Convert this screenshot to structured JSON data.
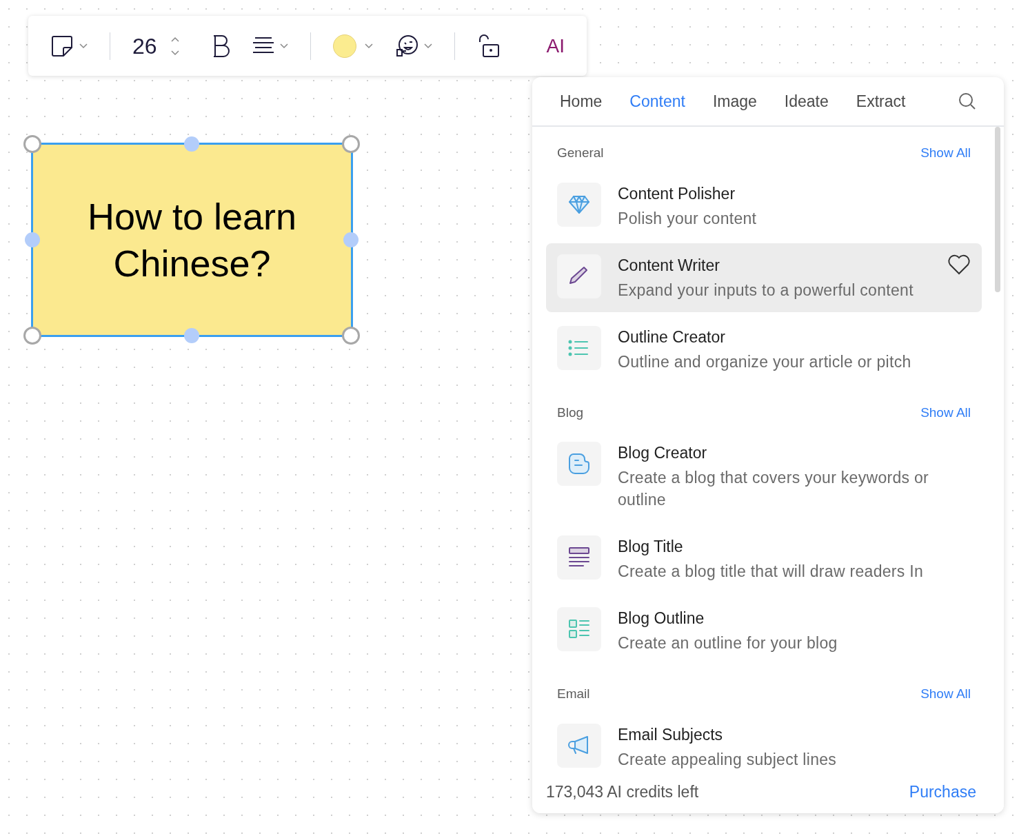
{
  "toolbar": {
    "font_size": "26",
    "ai_label": "AI"
  },
  "note": {
    "text": "How to learn Chinese?",
    "color": "#fbe98f",
    "selected": true
  },
  "panel": {
    "tabs": [
      {
        "label": "Home",
        "selected": false
      },
      {
        "label": "Content",
        "selected": true
      },
      {
        "label": "Image",
        "selected": false
      },
      {
        "label": "Ideate",
        "selected": false
      },
      {
        "label": "Extract",
        "selected": false
      }
    ],
    "sections": [
      {
        "title": "General",
        "action": "Show All",
        "items": [
          {
            "title": "Content Polisher",
            "description": "Polish your content",
            "selected": false
          },
          {
            "title": "Content Writer",
            "description": "Expand your inputs to a powerful content",
            "selected": true
          },
          {
            "title": "Outline Creator",
            "description": "Outline and organize your article or pitch",
            "selected": false
          }
        ]
      },
      {
        "title": "Blog",
        "action": "Show All",
        "items": [
          {
            "title": "Blog Creator",
            "description": "Create a blog that covers your keywords or outline",
            "selected": false
          },
          {
            "title": "Blog Title",
            "description": "Create a blog title that will draw readers In",
            "selected": false
          },
          {
            "title": "Blog Outline",
            "description": "Create an outline for your blog",
            "selected": false
          }
        ]
      },
      {
        "title": "Email",
        "action": "Show All",
        "items": [
          {
            "title": "Email Subjects",
            "description": "Create appealing subject lines",
            "selected": false
          }
        ]
      }
    ],
    "credits": "173,043 AI credits left",
    "purchase": "Purchase"
  }
}
